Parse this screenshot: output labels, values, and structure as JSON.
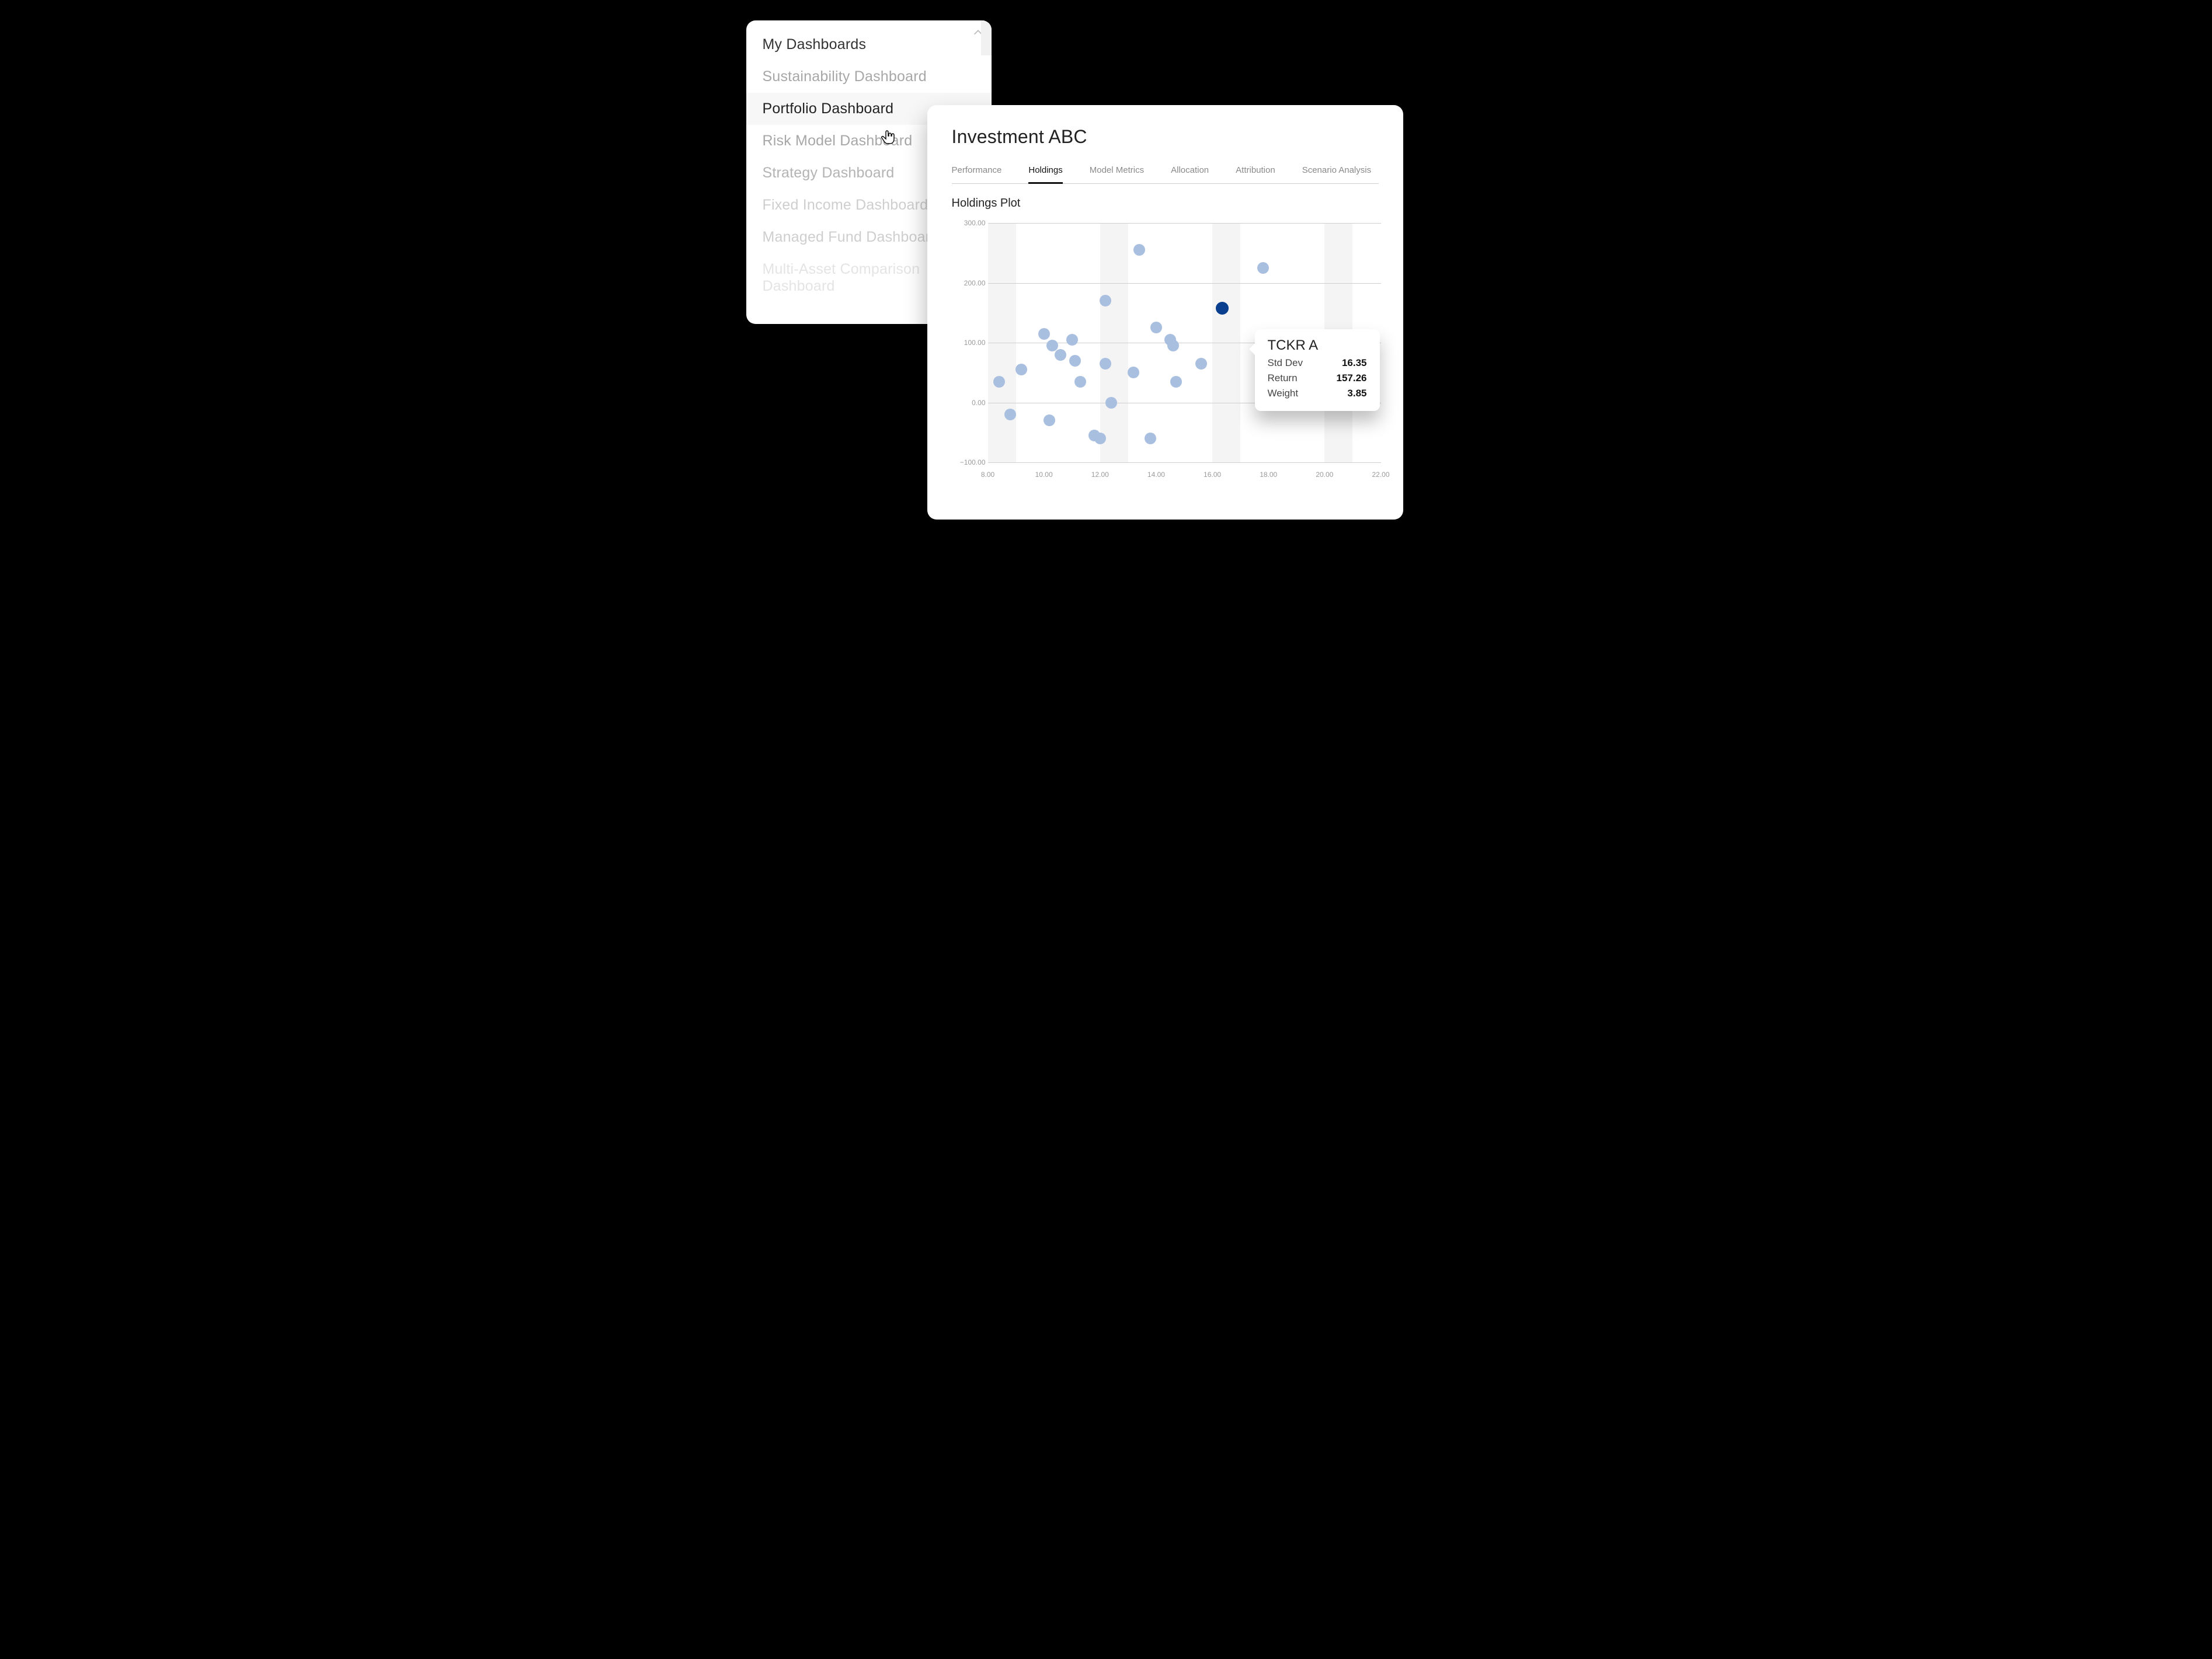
{
  "sidebar": {
    "items": [
      {
        "label": "My Dashboards",
        "level": 0
      },
      {
        "label": "Sustainability Dashboard",
        "level": 1
      },
      {
        "label": "Portfolio Dashboard",
        "level": 1,
        "active": true
      },
      {
        "label": "Risk Model Dashboard",
        "level": 1
      },
      {
        "label": "Strategy Dashboard",
        "level": 1,
        "fade": 1
      },
      {
        "label": "Fixed Income Dashboard",
        "level": 1,
        "fade": 2
      },
      {
        "label": "Managed Fund Dashboard",
        "level": 1,
        "fade": 2
      },
      {
        "label": "Multi-Asset Comparison Dashboard",
        "level": 1,
        "fade": 3
      }
    ]
  },
  "panel": {
    "title": "Investment ABC",
    "tabs": [
      {
        "label": "Performance"
      },
      {
        "label": "Holdings",
        "active": true
      },
      {
        "label": "Model Metrics"
      },
      {
        "label": "Allocation"
      },
      {
        "label": "Attribution"
      },
      {
        "label": "Scenario Analysis"
      }
    ],
    "subtitle": "Holdings Plot"
  },
  "tooltip": {
    "title": "TCKR A",
    "rows": [
      {
        "label": "Std Dev",
        "value": "16.35"
      },
      {
        "label": "Return",
        "value": "157.26"
      },
      {
        "label": "Weight",
        "value": "3.85"
      }
    ]
  },
  "chart_data": {
    "type": "scatter",
    "title": "Holdings Plot",
    "xlabel": "",
    "ylabel": "",
    "xlim": [
      8,
      22
    ],
    "ylim": [
      -100,
      300
    ],
    "xticks": [
      8,
      10,
      12,
      14,
      16,
      18,
      20,
      22
    ],
    "yticks": [
      -100,
      0,
      100,
      200,
      300
    ],
    "tick_format": "0.00",
    "series": [
      {
        "name": "Holdings",
        "points": [
          {
            "x": 8.4,
            "y": 35
          },
          {
            "x": 8.8,
            "y": -20
          },
          {
            "x": 9.2,
            "y": 55
          },
          {
            "x": 10.0,
            "y": 115
          },
          {
            "x": 10.3,
            "y": 95
          },
          {
            "x": 10.6,
            "y": 80
          },
          {
            "x": 10.2,
            "y": -30
          },
          {
            "x": 11.0,
            "y": 105
          },
          {
            "x": 11.1,
            "y": 70
          },
          {
            "x": 11.3,
            "y": 35
          },
          {
            "x": 11.8,
            "y": -55
          },
          {
            "x": 12.0,
            "y": -60
          },
          {
            "x": 12.2,
            "y": 170
          },
          {
            "x": 12.2,
            "y": 65
          },
          {
            "x": 12.4,
            "y": 0
          },
          {
            "x": 13.2,
            "y": 50
          },
          {
            "x": 13.4,
            "y": 255
          },
          {
            "x": 13.8,
            "y": -60
          },
          {
            "x": 14.0,
            "y": 125
          },
          {
            "x": 14.5,
            "y": 105
          },
          {
            "x": 14.6,
            "y": 95
          },
          {
            "x": 14.7,
            "y": 35
          },
          {
            "x": 15.6,
            "y": 65
          },
          {
            "x": 16.35,
            "y": 157.26,
            "selected": true,
            "ticker": "TCKR A",
            "weight": 3.85
          },
          {
            "x": 17.8,
            "y": 225
          }
        ]
      }
    ]
  }
}
